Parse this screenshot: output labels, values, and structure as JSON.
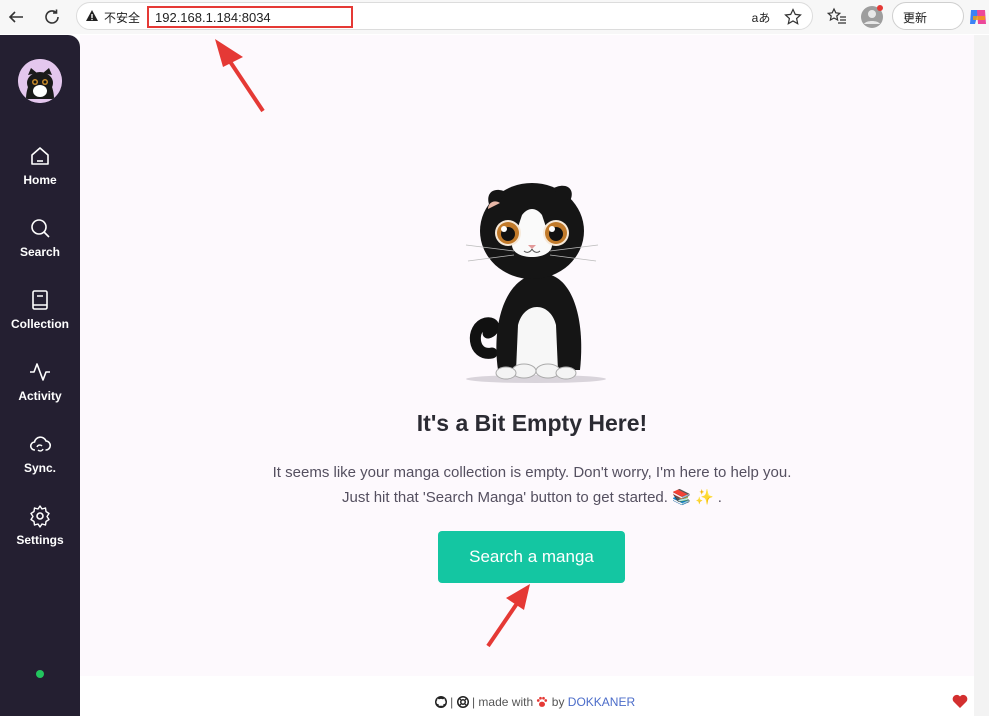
{
  "browser": {
    "security_label": "不安全",
    "url": "192.168.1.184:8034",
    "read_aloud_glyph": "aあ",
    "update_label": "更新",
    "more_label": "···"
  },
  "sidebar": {
    "items": [
      {
        "label": "Home",
        "icon": "home-icon"
      },
      {
        "label": "Search",
        "icon": "search-icon"
      },
      {
        "label": "Collection",
        "icon": "book-icon"
      },
      {
        "label": "Activity",
        "icon": "activity-icon"
      },
      {
        "label": "Sync.",
        "icon": "cloud-sync-icon"
      },
      {
        "label": "Settings",
        "icon": "gear-icon"
      }
    ],
    "status": "online"
  },
  "empty_state": {
    "title": "It's a Bit Empty Here!",
    "line1": "It seems like your manga collection is empty. Don't worry, I'm here to help you.",
    "line2": "Just hit that 'Search Manga' button to get started. 📚 ✨ .",
    "button": "Search a manga"
  },
  "footer": {
    "separator1": " | ",
    "separator2": " | made with ",
    "by": " by ",
    "author": "DOKKANER"
  },
  "colors": {
    "sidebar_bg": "#241f31",
    "accent": "#14c6a2",
    "annotation": "#e53935",
    "status_online": "#22c55e"
  }
}
